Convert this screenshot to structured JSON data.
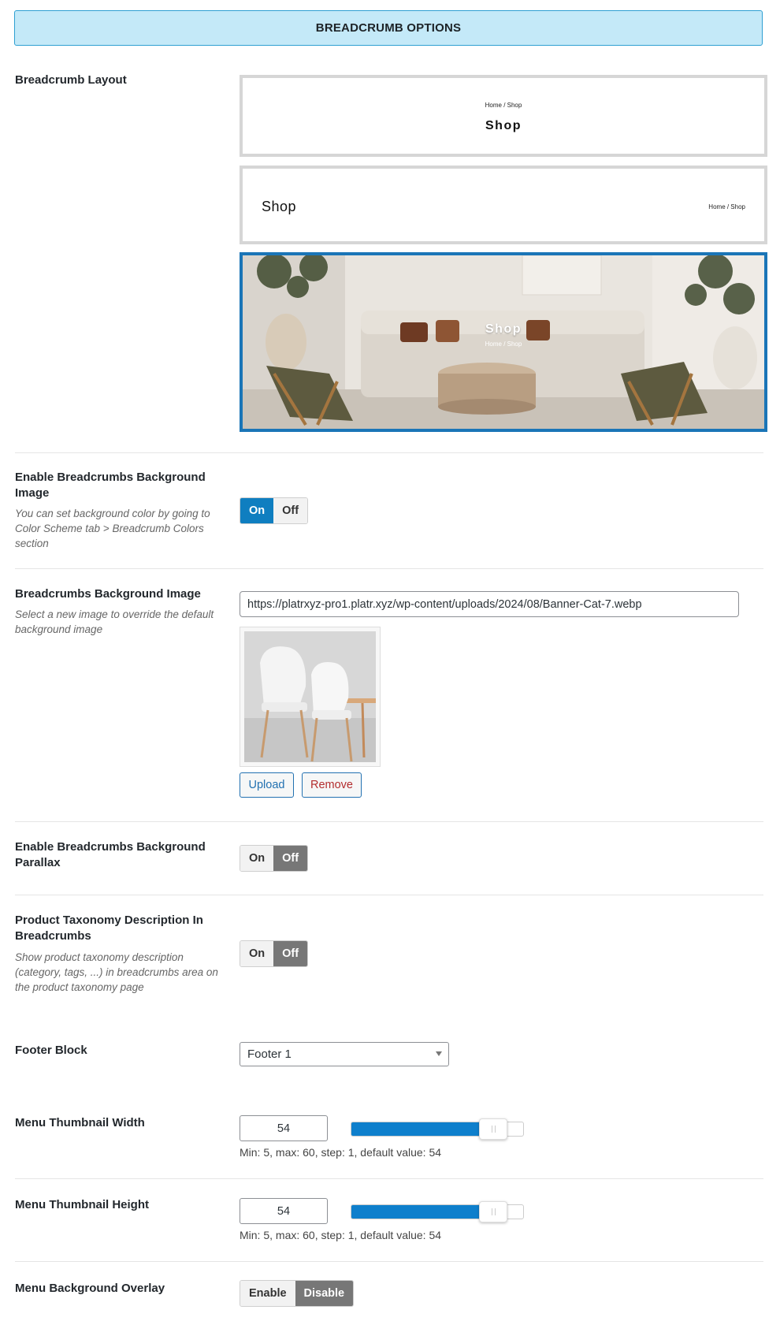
{
  "header": {
    "title": "BREADCRUMB OPTIONS"
  },
  "breadcrumb_layout": {
    "label": "Breadcrumb Layout",
    "layouts": [
      {
        "title": "Shop",
        "crumb": "Home / Shop",
        "selected": false
      },
      {
        "title": "Shop",
        "crumb": "Home / Shop",
        "selected": false
      },
      {
        "title": "Shop",
        "crumb": "Home / Shop",
        "selected": true
      }
    ]
  },
  "bg_image_toggle": {
    "label": "Enable Breadcrumbs Background Image",
    "description": "You can set background color by going to Color Scheme tab > Breadcrumb Colors section",
    "on_label": "On",
    "off_label": "Off",
    "value": "On"
  },
  "bg_image": {
    "label": "Breadcrumbs Background Image",
    "description": "Select a new image to override the default background image",
    "url": "https://platrxyz-pro1.platr.xyz/wp-content/uploads/2024/08/Banner-Cat-7.webp",
    "upload_label": "Upload",
    "remove_label": "Remove"
  },
  "parallax": {
    "label": "Enable Breadcrumbs Background Parallax",
    "on_label": "On",
    "off_label": "Off",
    "value": "Off"
  },
  "taxonomy_desc": {
    "label": "Product Taxonomy Description In Breadcrumbs",
    "description": "Show product taxonomy description (category, tags, ...) in breadcrumbs area on the product taxonomy page",
    "on_label": "On",
    "off_label": "Off",
    "value": "Off"
  },
  "footer_block": {
    "label": "Footer Block",
    "selected": "Footer 1"
  },
  "thumb_width": {
    "label": "Menu Thumbnail Width",
    "value": "54",
    "min": 5,
    "max": 60,
    "hint": "Min: 5, max: 60, step: 1, default value: 54"
  },
  "thumb_height": {
    "label": "Menu Thumbnail Height",
    "value": "54",
    "min": 5,
    "max": 60,
    "hint": "Min: 5, max: 60, step: 1, default value: 54"
  },
  "overlay": {
    "label": "Menu Background Overlay",
    "on_label": "Enable",
    "off_label": "Disable",
    "value": "Disable"
  },
  "colors": {
    "accent": "#0f7ec0",
    "header_bg": "#c4e9f8",
    "selected_border": "#1a75b7",
    "toggle_off_active": "#777777"
  }
}
